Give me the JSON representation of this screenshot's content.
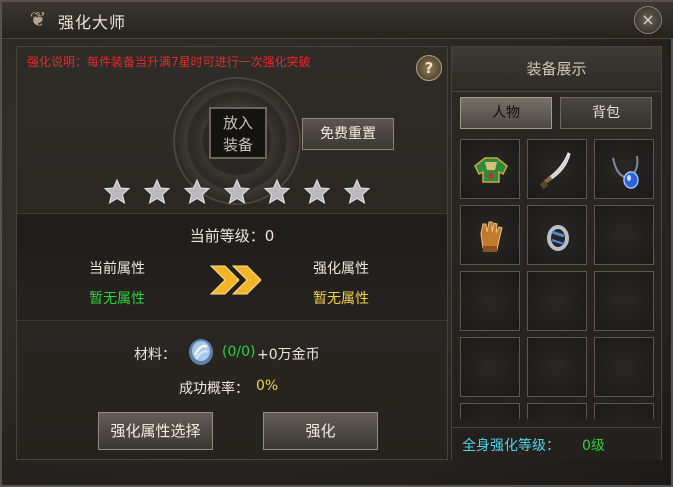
{
  "window": {
    "title": "强化大师",
    "close": "×"
  },
  "left": {
    "notice": "强化说明：每件装备当升满7星时可进行一次强化突破",
    "help": "?",
    "slot_text": "放入装备",
    "reset_button": "免费重置",
    "stars": {
      "total": 7,
      "filled": 0
    },
    "level_label": "当前等级：0",
    "current_attr_label": "当前属性",
    "current_attr_value": "暂无属性",
    "next_attr_label": "强化属性",
    "next_attr_value": "暂无属性",
    "material_label": "材料：",
    "material_count": "(0/0)",
    "material_gold": "+0万金币",
    "rate_label": "成功概率：",
    "rate_value": "0%",
    "attr_select_button": "强化属性选择",
    "enhance_button": "强化"
  },
  "right": {
    "title": "装备展示",
    "tabs": [
      "人物",
      "背包"
    ],
    "active_tab": "人物",
    "items": [
      "green-chest-armor-icon",
      "curved-saber-icon",
      "blue-necklace-icon",
      "golden-gauntlet-icon",
      "silver-ring-icon"
    ],
    "footer_label": "全身强化等级：",
    "footer_value": "0级"
  },
  "colors": {
    "notice": "#e22b2b",
    "green": "#2fd13a",
    "gold": "#f0d24a",
    "cyan": "#4fd4ea"
  }
}
